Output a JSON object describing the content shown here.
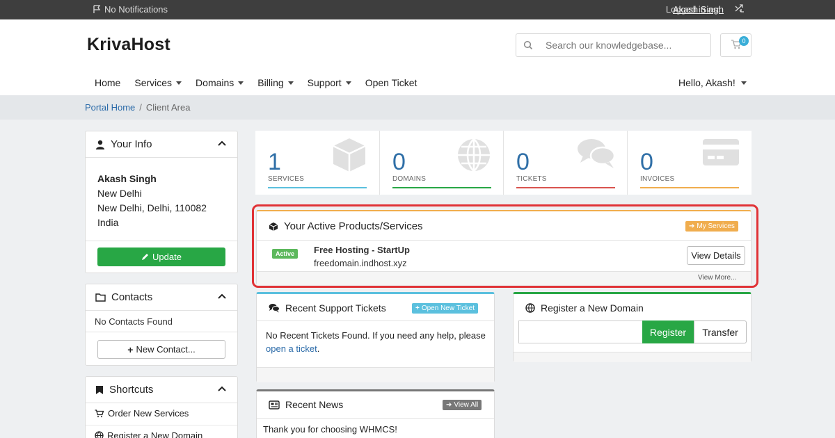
{
  "topbar": {
    "notifications": "No Notifications",
    "logged_in_label": "Logged in as:",
    "user_name": "Akash Singh"
  },
  "header": {
    "logo": "KrivaHost",
    "search_placeholder": "Search our knowledgebase...",
    "cart_count": "0"
  },
  "nav": {
    "items": [
      "Home",
      "Services",
      "Domains",
      "Billing",
      "Support",
      "Open Ticket"
    ],
    "greeting": "Hello, Akash!"
  },
  "breadcrumb": {
    "home": "Portal Home",
    "sep": "/",
    "current": "Client Area"
  },
  "your_info": {
    "title": "Your Info",
    "name": "Akash Singh",
    "city": "New Delhi",
    "address": "New Delhi, Delhi, 110082",
    "country": "India",
    "update_label": "Update"
  },
  "contacts": {
    "title": "Contacts",
    "empty": "No Contacts Found",
    "new_label": "New Contact..."
  },
  "shortcuts": {
    "title": "Shortcuts",
    "items": [
      "Order New Services",
      "Register a New Domain"
    ]
  },
  "stats": [
    {
      "value": "1",
      "label": "SERVICES"
    },
    {
      "value": "0",
      "label": "DOMAINS"
    },
    {
      "value": "0",
      "label": "TICKETS"
    },
    {
      "value": "0",
      "label": "INVOICES"
    }
  ],
  "colors": {
    "services": "#5bc0de",
    "domains": "#28a745",
    "tickets": "#d9534f",
    "invoices": "#f0ad4e",
    "accent": "#2f6fa7",
    "highlight": "#e03236"
  },
  "active_products": {
    "title": "Your Active Products/Services",
    "my_services_label": "My Services",
    "status": "Active",
    "product_name": "Free Hosting - StartUp",
    "product_domain": "freedomain.indhost.xyz",
    "view_details_label": "View Details",
    "view_more_label": "View More..."
  },
  "tickets": {
    "title": "Recent Support Tickets",
    "open_new_label": "Open New Ticket",
    "body_text": "No Recent Tickets Found. If you need any help, please",
    "link_text": "open a ticket",
    "period": "."
  },
  "register_domain": {
    "title": "Register a New Domain",
    "register_label": "Register",
    "transfer_label": "Transfer"
  },
  "news": {
    "title": "Recent News",
    "view_all_label": "View All",
    "first_item": "Thank you for choosing WHMCS!"
  }
}
